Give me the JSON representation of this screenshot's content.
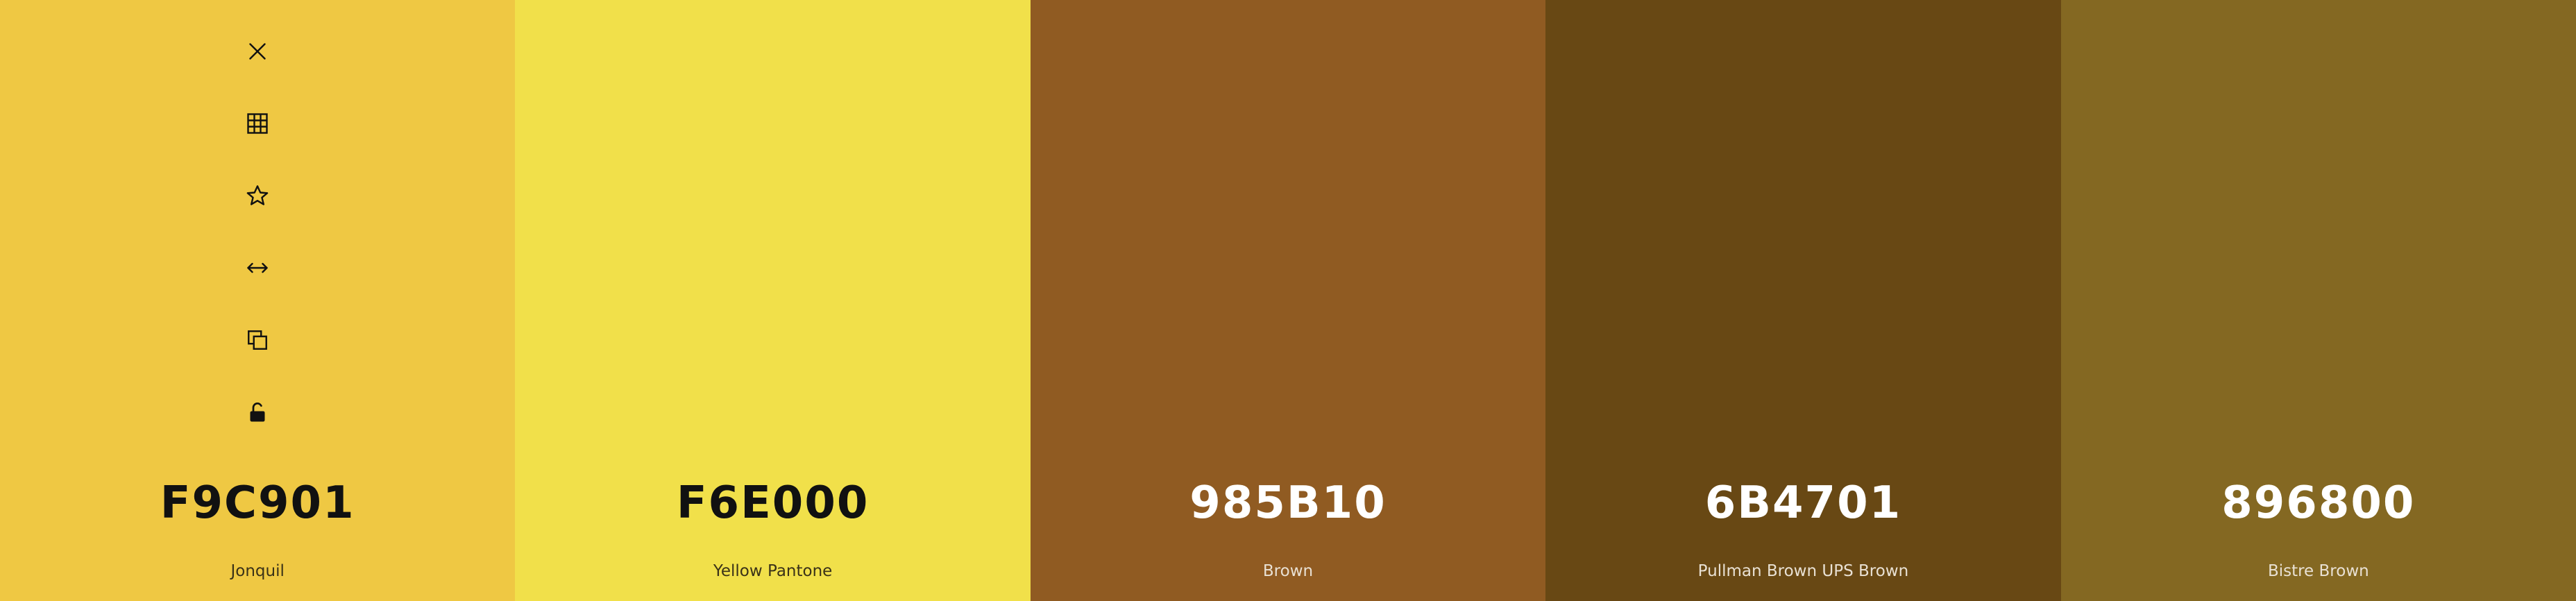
{
  "swatches": [
    {
      "hex": "F9C901",
      "name": "Jonquil",
      "color": "#EFC843",
      "text_theme": "light"
    },
    {
      "hex": "F6E000",
      "name": "Yellow Pantone",
      "color": "#F1E04A",
      "text_theme": "light"
    },
    {
      "hex": "985B10",
      "name": "Brown",
      "color": "#905B22",
      "text_theme": "dark"
    },
    {
      "hex": "6B4701",
      "name": "Pullman Brown UPS Brown",
      "color": "#684814",
      "text_theme": "dark"
    },
    {
      "hex": "896800",
      "name": "Bistre Brown",
      "color": "#846822",
      "text_theme": "dark"
    }
  ],
  "toolbar": {
    "icons": [
      "close-icon",
      "grid-icon",
      "star-icon",
      "arrows-horizontal-icon",
      "copy-icon",
      "lock-open-icon"
    ]
  }
}
